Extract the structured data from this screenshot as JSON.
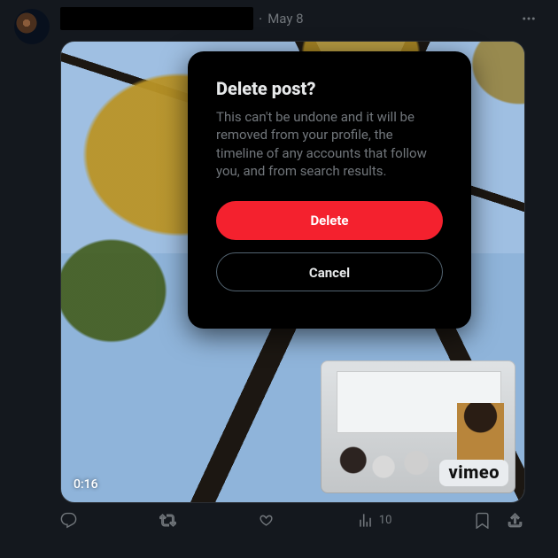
{
  "post": {
    "date": "May 8",
    "separator": "·",
    "video_duration": "0:16",
    "overlay_brand": "vimeo"
  },
  "actions": {
    "views_count": "10"
  },
  "modal": {
    "title": "Delete post?",
    "body": "This can't be undone and it will be removed from your profile, the timeline of any accounts that follow you, and from search results.",
    "delete_label": "Delete",
    "cancel_label": "Cancel"
  }
}
